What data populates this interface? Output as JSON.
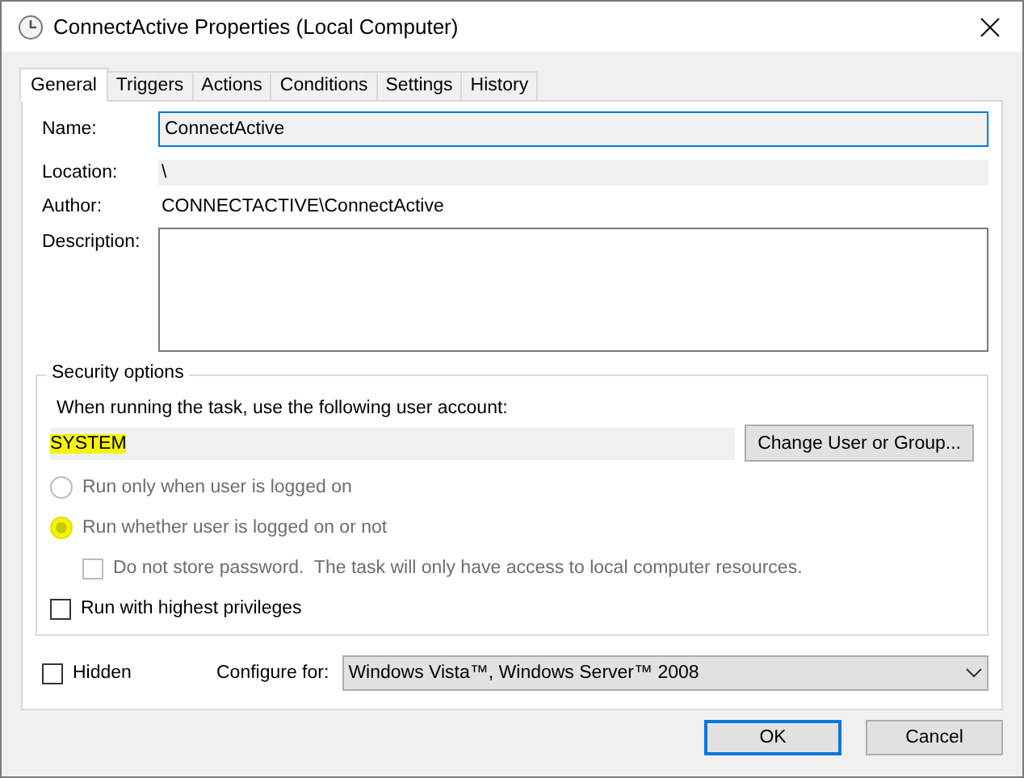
{
  "window": {
    "title": "ConnectActive Properties (Local Computer)"
  },
  "tabs": [
    {
      "label": "General",
      "selected": true
    },
    {
      "label": "Triggers",
      "selected": false
    },
    {
      "label": "Actions",
      "selected": false
    },
    {
      "label": "Conditions",
      "selected": false
    },
    {
      "label": "Settings",
      "selected": false
    },
    {
      "label": "History",
      "selected": false
    }
  ],
  "general": {
    "name": {
      "label": "Name:",
      "value": "ConnectActive",
      "focused": true
    },
    "location": {
      "label": "Location:",
      "value": "\\"
    },
    "author": {
      "label": "Author:",
      "value": "CONNECTACTIVE\\ConnectActive"
    },
    "description": {
      "label": "Description:"
    }
  },
  "security": {
    "title": "Security options",
    "prompt": "When running the task, use the following user account:",
    "account": {
      "value": "SYSTEM",
      "highlighted": true
    },
    "change_button": "Change User or Group...",
    "options": [
      {
        "kind": "radio",
        "label": "Run only when user is logged on",
        "selected": false,
        "disabled": true,
        "highlighted": false
      },
      {
        "kind": "radio",
        "label": "Run whether user is logged on or not",
        "selected": true,
        "disabled": true,
        "highlighted": true,
        "children": [
          {
            "kind": "checkbox",
            "label": "Do not store password.  The task will only have access to local computer resources.",
            "checked": false,
            "disabled": true
          }
        ]
      },
      {
        "kind": "checkbox",
        "label": "Run with highest privileges",
        "checked": false,
        "disabled": false
      }
    ]
  },
  "hidden": {
    "label": "Hidden",
    "checked": false
  },
  "configure": {
    "label": "Configure for:",
    "value": "Windows Vista™, Windows Server™ 2008"
  },
  "buttons": [
    {
      "label": "OK",
      "default": true
    },
    {
      "label": "Cancel",
      "default": false
    }
  ]
}
